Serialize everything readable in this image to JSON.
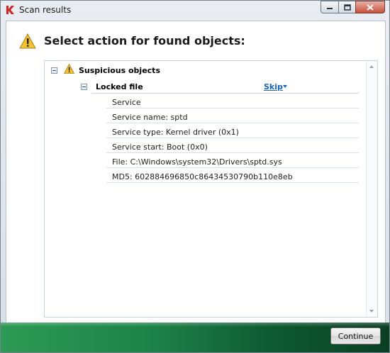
{
  "window": {
    "title": "Scan results"
  },
  "header": {
    "title": "Select action for found objects:"
  },
  "group": {
    "label": "Suspicious objects",
    "item": {
      "label": "Locked file",
      "action": "Skip",
      "details": [
        "Service",
        "Service name: sptd",
        "Service type: Kernel driver (0x1)",
        "Service start: Boot (0x0)",
        "File: C:\\Windows\\system32\\Drivers\\sptd.sys",
        "MD5: 602884696850c86434530790b110e8eb"
      ]
    }
  },
  "footer": {
    "continue_label": "Continue"
  },
  "colors": {
    "link": "#1565c0",
    "footer_green": "#1c8247",
    "warning": "#f2c230"
  }
}
